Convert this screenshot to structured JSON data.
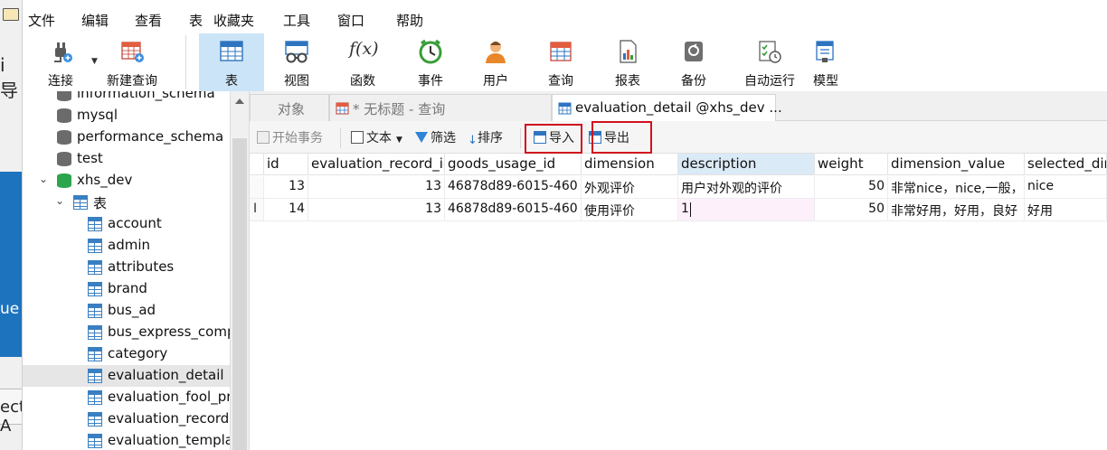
{
  "menu": [
    "文件",
    "编辑",
    "查看",
    "表",
    "收藏夹",
    "工具",
    "窗口",
    "帮助"
  ],
  "left_fragments": {
    "a": "i导",
    "b": "ue",
    "c": "ect A"
  },
  "toolbar": {
    "items": [
      {
        "label": "连接",
        "icon": "plug-icon"
      },
      {
        "label": "新建查询",
        "icon": "new-query-icon"
      },
      {
        "label": "表",
        "icon": "table-icon"
      },
      {
        "label": "视图",
        "icon": "view-icon"
      },
      {
        "label": "函数",
        "icon": "function-icon"
      },
      {
        "label": "事件",
        "icon": "clock-icon"
      },
      {
        "label": "用户",
        "icon": "user-icon"
      },
      {
        "label": "查询",
        "icon": "query-icon"
      },
      {
        "label": "报表",
        "icon": "report-icon"
      },
      {
        "label": "备份",
        "icon": "backup-icon"
      },
      {
        "label": "自动运行",
        "icon": "automation-icon"
      },
      {
        "label": "模型",
        "icon": "model-icon"
      }
    ],
    "fx_glyph": "f(x)"
  },
  "tree": {
    "databases": [
      "information_schema",
      "mysql",
      "performance_schema",
      "test",
      "xhs_dev"
    ],
    "tables_folder": "表",
    "tables": [
      "account",
      "admin",
      "attributes",
      "brand",
      "bus_ad",
      "bus_express_comp",
      "category",
      "evaluation_detail",
      "evaluation_fool_pr",
      "evaluation_record",
      "evaluation_templat"
    ]
  },
  "tabs": {
    "objects": "对象",
    "untitled": "* 无标题 - 查询",
    "active": "evaluation_detail @xhs_dev ..."
  },
  "data_toolbar": {
    "begin_tx": "开始事务",
    "text": "文本",
    "filter": "筛选",
    "sort": "排序",
    "import": "导入",
    "export": "导出"
  },
  "grid": {
    "columns": [
      "id",
      "evaluation_record_id",
      "goods_usage_id",
      "dimension",
      "description",
      "weight",
      "dimension_value",
      "selected_di"
    ],
    "column_header_display": [
      "id",
      "evaluation_record_ic",
      "goods_usage_id",
      "dimension",
      "description",
      "weight",
      "dimension_value",
      "selected_dir"
    ],
    "rows": [
      {
        "id": "13",
        "evaluation_record_id": "13",
        "goods_usage_id": "46878d89-6015-460",
        "dimension": "外观评价",
        "description": "用户对外观的评价",
        "weight": "50",
        "dimension_value": "非常nice，nice,一般，",
        "selected": "nice"
      },
      {
        "id": "14",
        "evaluation_record_id": "13",
        "goods_usage_id": "46878d89-6015-460",
        "dimension": "使用评价",
        "description": "1",
        "weight": "50",
        "dimension_value": "非常好用，好用，良好",
        "selected": "好用"
      }
    ],
    "row_indicator": "I"
  },
  "colors": {
    "accent": "#cce4f7",
    "highlight_box": "#d0121e",
    "column_highlight": "#dbeaf7",
    "edit_cell": "#fdf0fb"
  }
}
